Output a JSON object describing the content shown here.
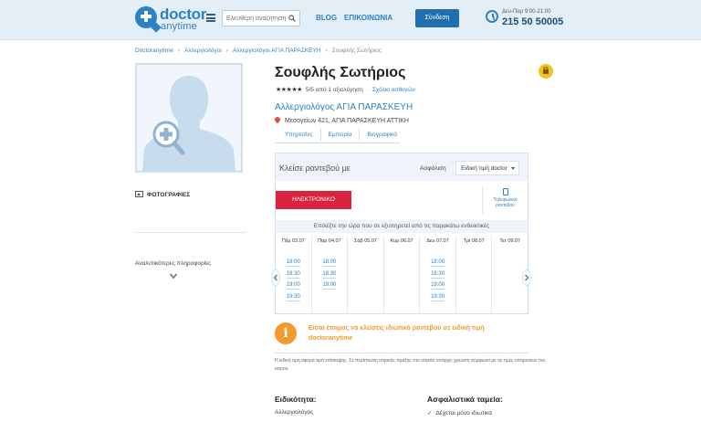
{
  "header": {
    "logo_word1": "doctor",
    "logo_word2": "anytime",
    "search_placeholder": "Ελεύθερη αναζήτηση",
    "nav": {
      "blog": "BLOG",
      "contact": "ΕΠΙΚΟΙΝΩΝΙΑ"
    },
    "login_label": "Σύνδεση",
    "hours": "Δευ-Παρ   9:00-21:00",
    "phone": "215 50 50005"
  },
  "breadcrumb": [
    "Doctoranytime",
    "Αλλεργιολόγοι",
    "Αλλεργιολόγοι ΑΓΙΑ ΠΑΡΑΣΚΕΥΗ",
    "Σουφλής Σωτήριος"
  ],
  "sidebar": {
    "photos_label": "ΦΩΤΟΓΡΑΦΙΕΣ",
    "more_info_label": "Αναλυτικότερες πληροφορίες"
  },
  "profile": {
    "name": "Σουφλής Σωτήριος",
    "stars": "★★★★★",
    "rating_text": "5/5 από 1 αξιολόγηση",
    "reviews_link": "Σχόλια ασθενών",
    "specialty": "Αλλεργιολόγος ΑΓΙΑ ΠΑΡΑΣΚΕΥΗ",
    "address": "Μεσογείων 421, ΑΓΙΑ ΠΑΡΑΣΚΕΥΗ ΑΤΤΙΚΗ",
    "tabs": [
      "Υπηρεσίες",
      "Εμπειρία",
      "Βιογραφικό"
    ]
  },
  "booking": {
    "title": "Κλείσε ραντεβού με",
    "insurance_label": "Ασφάλιση",
    "insurance_value": "Ειδική τιμή doctor",
    "ebook_label": "ΗΛΕΚΤΡΟΝΙΚΟ ΡΑΝΤΕΒΟΥ",
    "phone_book_line1": "Τηλεφωνικό",
    "phone_book_line2": "ραντεβού",
    "instructions": "Επιλέξτε την ώρα που σε εξυπηρετεί από τις παρακάτω ενδεικτικές",
    "days": [
      {
        "label": "Πέμ 03.07",
        "slots": [
          "18:00",
          "18:30",
          "19:00",
          "19:30"
        ]
      },
      {
        "label": "Παρ 04.07",
        "slots": [
          "18:00",
          "18:30",
          "19:00"
        ]
      },
      {
        "label": "Σάβ 05.07",
        "slots": []
      },
      {
        "label": "Κυρ 06.07",
        "slots": []
      },
      {
        "label": "Δευ 07.07",
        "slots": [
          "18:00",
          "18:30",
          "19:00",
          "19:30"
        ]
      },
      {
        "label": "Τρί 08.07",
        "slots": []
      },
      {
        "label": "Τετ 09.07",
        "slots": []
      }
    ]
  },
  "notice": {
    "icon_glyph": "i",
    "text": "Είσαι έτοιμος να κλείσεις ιδιωτικό ραντεβού σε ειδική τιμή doctoranytime",
    "footnote": "Η ειδική τιμή αφορά τιμή επίσκεψης. Σε περίπτωση ιατρικής πράξης στο ιατρείο υπάρχει χρέωση σύμφωνα με τις τιμές υπηρεσιών του ιατρού."
  },
  "details": {
    "specialty_title": "Ειδικότητα:",
    "specialty_value": "Αλλεργιολόγος",
    "insurance_title": "Ασφαλιστικά ταμεία:",
    "insurance_value": "Δέχεται μόνο ιδιωτικά"
  },
  "colors": {
    "brand": "#2e82c4",
    "cta": "#d9233f",
    "accent": "#f29a2b",
    "badge": "#f3c21b"
  }
}
